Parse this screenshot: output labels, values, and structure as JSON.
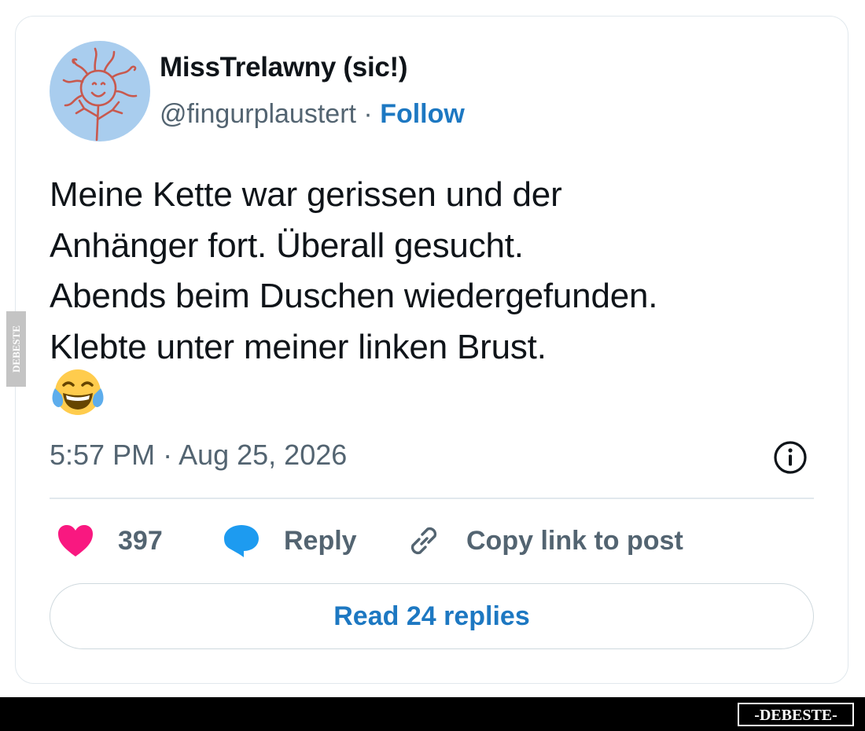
{
  "tweet": {
    "author_name": "MissTrelawny (sic!)",
    "handle": "@fingurplaustert",
    "separator": " · ",
    "follow_label": "Follow",
    "text_lines": [
      "Meine Kette war gerissen und der",
      "Anhänger fort. Überall gesucht.",
      "Abends beim Duschen wiedergefunden.",
      "Klebte unter meiner linken Brust."
    ],
    "emoji": "face-with-tears-of-joy",
    "timestamp": "5:57 PM · Aug 25, 2026"
  },
  "actions": {
    "like_count": "397",
    "reply_label": "Reply",
    "copy_link_label": "Copy link to post"
  },
  "read_replies_label": "Read 24 replies",
  "watermark": {
    "side_text": "DEBESTE",
    "footer_logo": "-DEBESTE-"
  },
  "icons": {
    "avatar": "sun-doodle-avatar",
    "info": "info-icon",
    "like": "heart-icon",
    "reply": "speech-bubble-icon",
    "copy_link": "link-icon"
  },
  "colors": {
    "link_blue": "#1d78c2",
    "heart_pink": "#f91880",
    "reply_blue": "#1d9bf0",
    "avatar_bg": "#a9cdee",
    "text_gray": "#536471"
  }
}
